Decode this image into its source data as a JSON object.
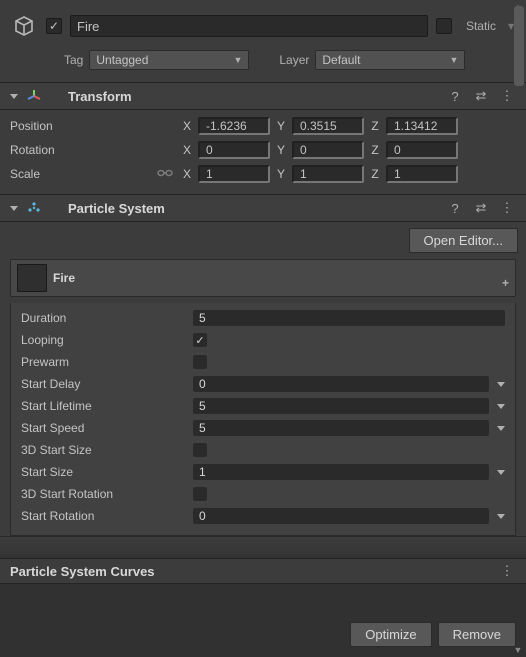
{
  "header": {
    "active_checked": true,
    "name": "Fire",
    "static_label": "Static",
    "static_checked": false
  },
  "tag_layer": {
    "tag_label": "Tag",
    "tag_value": "Untagged",
    "layer_label": "Layer",
    "layer_value": "Default"
  },
  "transform": {
    "title": "Transform",
    "position_label": "Position",
    "rotation_label": "Rotation",
    "scale_label": "Scale",
    "x_label": "X",
    "y_label": "Y",
    "z_label": "Z",
    "position": {
      "x": "-1.6236",
      "y": "0.3515",
      "z": "1.13412"
    },
    "rotation": {
      "x": "0",
      "y": "0",
      "z": "0"
    },
    "scale": {
      "x": "1",
      "y": "1",
      "z": "1"
    }
  },
  "particle_system": {
    "title": "Particle System",
    "open_editor_label": "Open Editor...",
    "module_name": "Fire",
    "props": {
      "duration_label": "Duration",
      "duration": "5",
      "looping_label": "Looping",
      "looping_checked": true,
      "prewarm_label": "Prewarm",
      "prewarm_checked": false,
      "start_delay_label": "Start Delay",
      "start_delay": "0",
      "start_lifetime_label": "Start Lifetime",
      "start_lifetime": "5",
      "start_speed_label": "Start Speed",
      "start_speed": "5",
      "start_size_3d_label": "3D Start Size",
      "start_size_3d_checked": false,
      "start_size_label": "Start Size",
      "start_size": "1",
      "start_rotation_3d_label": "3D Start Rotation",
      "start_rotation_3d_checked": false,
      "start_rotation_label": "Start Rotation",
      "start_rotation": "0"
    }
  },
  "curves": {
    "title": "Particle System Curves"
  },
  "footer": {
    "optimize_label": "Optimize",
    "remove_label": "Remove"
  },
  "icons": {
    "help": "?",
    "preset": "⇄",
    "menu": "⋮"
  }
}
